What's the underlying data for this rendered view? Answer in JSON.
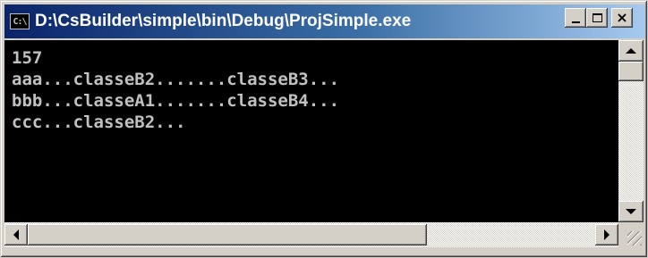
{
  "window": {
    "title": "D:\\CsBuilder\\simple\\bin\\Debug\\ProjSimple.exe",
    "icon": "console-icon",
    "icon_text": "C:\\"
  },
  "console": {
    "lines": [
      "157",
      "aaa...classeB2.......classeB3...",
      "bbb...classeA1.......classeB4...",
      "ccc...classeB2..."
    ]
  },
  "colors": {
    "console_bg": "#000000",
    "console_text": "#c0c0c0",
    "titlebar_start": "#0a246a",
    "titlebar_end": "#a6caf0"
  }
}
